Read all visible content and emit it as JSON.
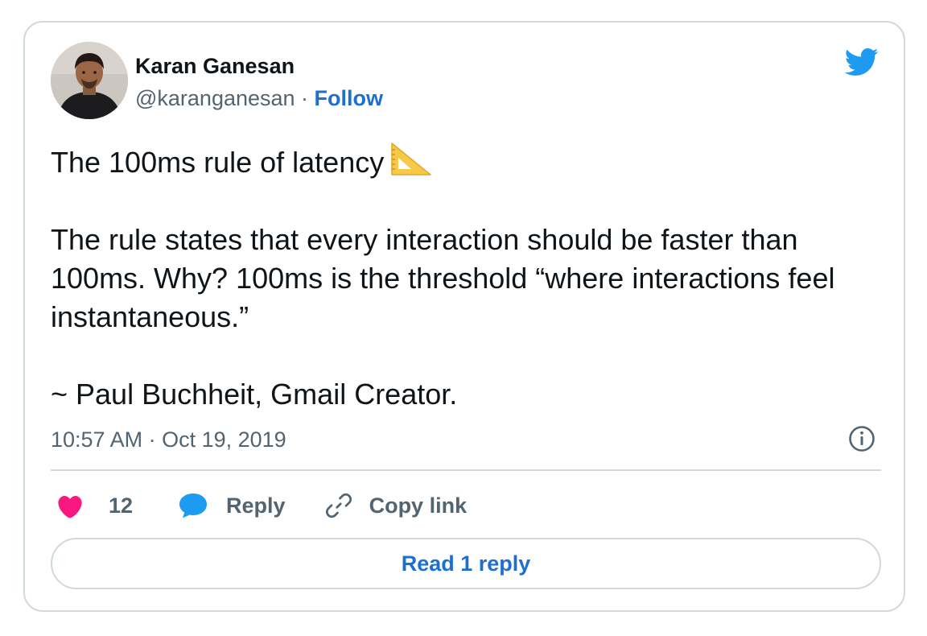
{
  "author": {
    "name": "Karan Ganesan",
    "handle": "@karanganesan",
    "separator": " · ",
    "follow_label": "Follow"
  },
  "tweet": {
    "headline": "The 100ms rule of latency",
    "headline_emoji_icon": "triangular-ruler-icon",
    "paragraph": "The rule states that every interaction should be faster than 100ms. Why? 100ms is the threshold “where interactions feel instantaneous.”",
    "attribution": "~ Paul Buchheit, Gmail Creator."
  },
  "meta": {
    "timestamp": "10:57 AM · Oct 19, 2019"
  },
  "actions": {
    "like_count": "12",
    "reply_label": "Reply",
    "copy_link_label": "Copy link"
  },
  "read_replies_label": "Read 1 reply",
  "icons": {
    "brand": "twitter-bird-icon",
    "info": "info-icon",
    "like": "heart-icon",
    "reply": "speech-bubble-icon",
    "copy": "link-icon"
  },
  "colors": {
    "twitter_blue": "#1d9bf0",
    "link_blue": "#1d6fd1",
    "like_pink": "#f91880",
    "secondary_text": "#536471",
    "border": "#cfd9de"
  }
}
